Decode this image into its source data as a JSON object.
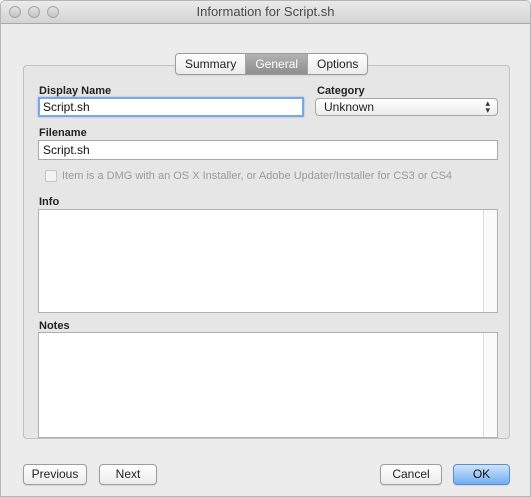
{
  "window": {
    "title": "Information for Script.sh"
  },
  "tabs": [
    {
      "label": "Summary",
      "active": false
    },
    {
      "label": "General",
      "active": true
    },
    {
      "label": "Options",
      "active": false
    }
  ],
  "fields": {
    "display_name_label": "Display Name",
    "display_name_value": "Script.sh",
    "category_label": "Category",
    "category_value": "Unknown",
    "filename_label": "Filename",
    "filename_value": "Script.sh",
    "dmg_checkbox_label": "Item is a DMG with an OS X Installer, or Adobe Updater/Installer for CS3 or CS4",
    "dmg_checkbox_checked": false,
    "info_label": "Info",
    "notes_label": "Notes"
  },
  "buttons": {
    "previous": "Previous",
    "next": "Next",
    "cancel": "Cancel",
    "ok": "OK"
  },
  "colors": {
    "accent": "#71aef3",
    "focus_ring": "#7aa7e6",
    "active_tab": "#8e8e8e"
  }
}
